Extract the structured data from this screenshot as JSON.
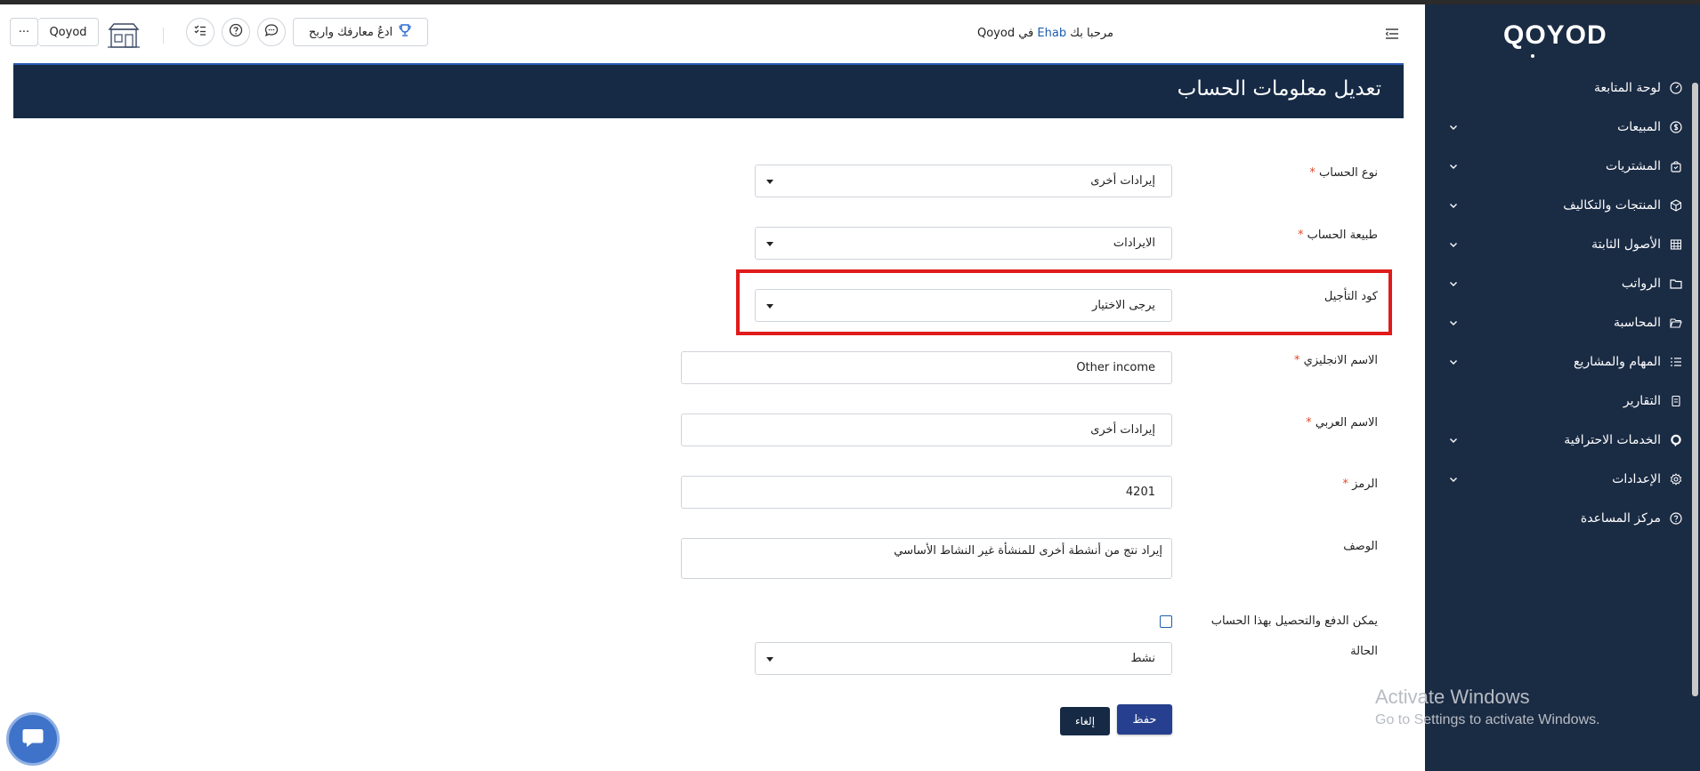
{
  "header": {
    "welcome_prefix": "مرحبا بك",
    "user_name": "Ehab",
    "welcome_suffix": "في Qoyod",
    "invite_label": "ادعُ معارفك واربح",
    "company_label": "Qoyod",
    "more_label": "···"
  },
  "sidebar": {
    "logo_text": "QOYOD",
    "items": [
      {
        "label": "لوحة المتابعة",
        "icon": "dashboard-icon",
        "expandable": false
      },
      {
        "label": "المبيعات",
        "icon": "dollar-icon",
        "expandable": true
      },
      {
        "label": "المشتريات",
        "icon": "bag-icon",
        "expandable": true
      },
      {
        "label": "المنتجات والتكاليف",
        "icon": "box-icon",
        "expandable": true
      },
      {
        "label": "الأصول الثابتة",
        "icon": "grid-icon",
        "expandable": true
      },
      {
        "label": "الرواتب",
        "icon": "folder-icon",
        "expandable": true
      },
      {
        "label": "المحاسبة",
        "icon": "folder-open-icon",
        "expandable": true
      },
      {
        "label": "المهام والمشاريع",
        "icon": "list-icon",
        "expandable": true
      },
      {
        "label": "التقارير",
        "icon": "report-icon",
        "expandable": false
      },
      {
        "label": "الخدمات الاحترافية",
        "icon": "qoyod-o-icon",
        "expandable": true
      },
      {
        "label": "الإعدادات",
        "icon": "gear-icon",
        "expandable": true
      },
      {
        "label": "مركز المساعدة",
        "icon": "help-icon",
        "expandable": false
      }
    ]
  },
  "page": {
    "title": "تعديل معلومات الحساب"
  },
  "form": {
    "account_type": {
      "label": "نوع الحساب",
      "required": "*",
      "value": "إيرادات أخرى"
    },
    "account_nature": {
      "label": "طبيعة الحساب",
      "required": "*",
      "value": "الايرادات"
    },
    "deferral_code": {
      "label": "كود التأجيل",
      "value": "يرجى الاختيار"
    },
    "english_name": {
      "label": "الاسم الانجليزي",
      "required": "*",
      "value": "Other income"
    },
    "arabic_name": {
      "label": "الاسم العربي",
      "required": "*",
      "value": "إيرادات أخرى"
    },
    "code": {
      "label": "الرمز",
      "required": "*",
      "value": "4201"
    },
    "description": {
      "label": "الوصف",
      "value": "إيراد نتج من أنشطة أخرى للمنشأة غير النشاط الأساسي"
    },
    "payment_checkbox": {
      "label": "يمكن الدفع والتحصيل بهذا الحساب",
      "checked": false
    },
    "status": {
      "label": "الحالة",
      "value": "نشط"
    },
    "save_label": "حفظ",
    "cancel_label": "إلغاء"
  },
  "watermark": {
    "line1": "Activate Windows",
    "line2": "Go to Settings to activate Windows."
  },
  "colors": {
    "sidebar_bg": "#1a2b44",
    "card_header_bg": "#162a45",
    "primary": "#263f8e",
    "required": "#e04a2e",
    "highlight": "#e01b1b"
  }
}
